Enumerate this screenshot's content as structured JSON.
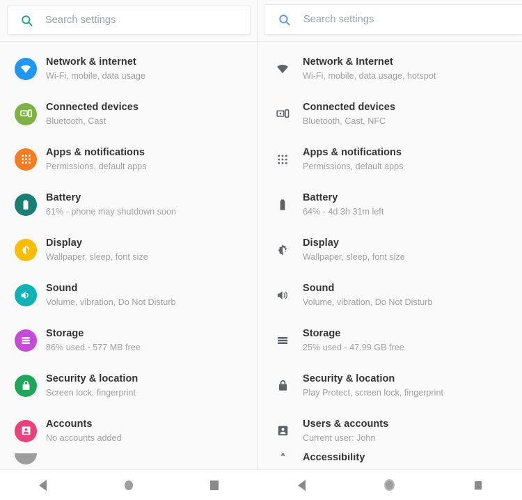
{
  "left_panel": {
    "search": {
      "placeholder": "Search settings",
      "icon": "search-icon",
      "icon_color": "#1a9e84"
    },
    "items": [
      {
        "title": "Network & internet",
        "subtitle": "Wi-Fi, mobile, data usage",
        "icon": "wifi-icon",
        "color": "#2196f3"
      },
      {
        "title": "Connected devices",
        "subtitle": "Bluetooth, Cast",
        "icon": "connected-devices-icon",
        "color": "#7cb342"
      },
      {
        "title": "Apps & notifications",
        "subtitle": "Permissions, default apps",
        "icon": "apps-grid-icon",
        "color": "#f57c20"
      },
      {
        "title": "Battery",
        "subtitle": "61% - phone may shutdown soon",
        "icon": "battery-icon",
        "color": "#1a7f72"
      },
      {
        "title": "Display",
        "subtitle": "Wallpaper, sleep, font size",
        "icon": "brightness-icon",
        "color": "#fbbc04"
      },
      {
        "title": "Sound",
        "subtitle": "Volume, vibration, Do Not Disturb",
        "icon": "volume-icon",
        "color": "#0fb3b5"
      },
      {
        "title": "Storage",
        "subtitle": "86% used - 577 MB free",
        "icon": "storage-icon",
        "color": "#c64bd6"
      },
      {
        "title": "Security & location",
        "subtitle": "Screen lock, fingerprint",
        "icon": "lock-icon",
        "color": "#1ea75a"
      },
      {
        "title": "Accounts",
        "subtitle": "No accounts added",
        "icon": "account-icon",
        "color": "#ec407a"
      }
    ],
    "partial_item": {
      "title": "",
      "subtitle": "",
      "icon": "accessibility-icon",
      "color": "#8a8a8a"
    },
    "navbar": {
      "back": "back-button",
      "home": "home-button",
      "recents": "recents-button"
    }
  },
  "right_panel": {
    "search": {
      "placeholder": "Search settings",
      "icon": "search-icon",
      "icon_color": "#5b8def"
    },
    "items": [
      {
        "title": "Network & Internet",
        "subtitle": "Wi-Fi, mobile, data usage, hotspot",
        "icon": "wifi-icon"
      },
      {
        "title": "Connected devices",
        "subtitle": "Bluetooth, Cast, NFC",
        "icon": "connected-devices-icon"
      },
      {
        "title": "Apps & notifications",
        "subtitle": "Permissions, default apps",
        "icon": "apps-grid-icon"
      },
      {
        "title": "Battery",
        "subtitle": "64% - 4d 3h 31m left",
        "icon": "battery-icon"
      },
      {
        "title": "Display",
        "subtitle": "Wallpaper, sleep, font size",
        "icon": "brightness-icon"
      },
      {
        "title": "Sound",
        "subtitle": "Volume, vibration, Do Not Disturb",
        "icon": "volume-icon"
      },
      {
        "title": "Storage",
        "subtitle": "25% used - 47.99 GB free",
        "icon": "storage-icon"
      },
      {
        "title": "Security & location",
        "subtitle": "Play Protect, screen lock, fingerprint",
        "icon": "lock-icon"
      },
      {
        "title": "Users & accounts",
        "subtitle": "Current user: John",
        "icon": "account-icon"
      }
    ],
    "partial_item": {
      "title": "Accessibility",
      "subtitle": "",
      "icon": "accessibility-icon"
    },
    "icon_color": "#5f6368",
    "navbar": {
      "back": "back-button",
      "home": "home-button",
      "recents": "recents-button"
    }
  }
}
